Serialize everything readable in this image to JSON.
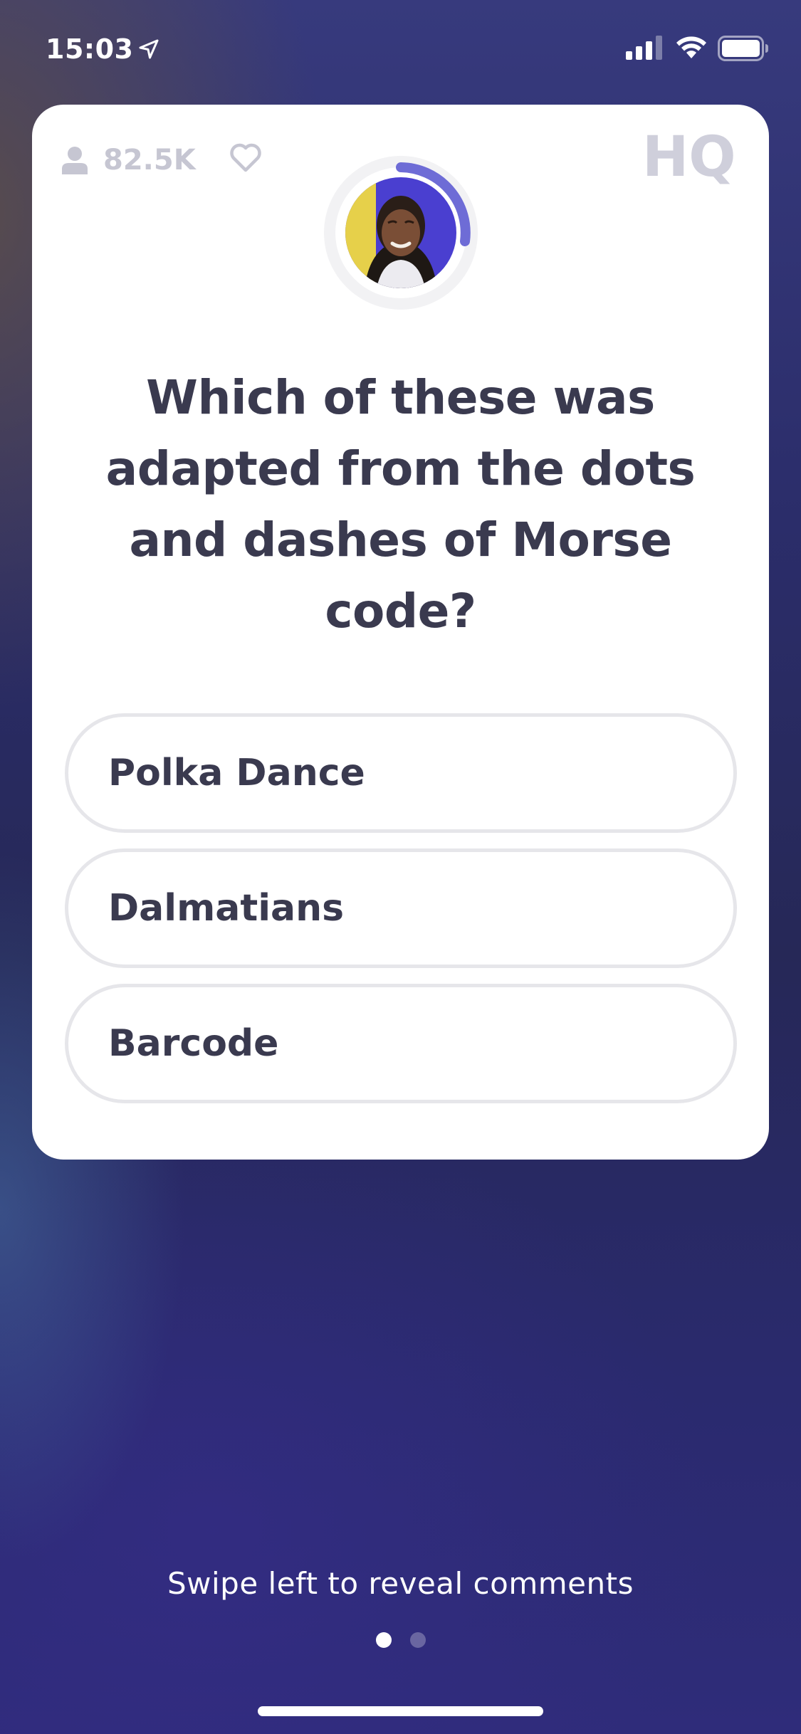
{
  "status_bar": {
    "time": "15:03",
    "icons": [
      "location-arrow-icon",
      "cellular-signal-icon",
      "wifi-icon",
      "battery-icon"
    ]
  },
  "header": {
    "viewer_count": "82.5K",
    "person_icon": "person-icon",
    "heart_icon": "heart-icon",
    "logo": "HQ"
  },
  "host": {
    "avatar_icon": "host-avatar",
    "timer_color": "#6e6cd6"
  },
  "question": {
    "text": "Which of these was adapted from the dots and dashes of Morse code?"
  },
  "answers": [
    {
      "label": "Polka Dance"
    },
    {
      "label": "Dalmatians"
    },
    {
      "label": "Barcode"
    }
  ],
  "footer": {
    "swipe_hint": "Swipe left to reveal comments",
    "pages": 2,
    "active_page": 1
  },
  "colors": {
    "background": "#2a2b6b",
    "card": "#ffffff",
    "text_dark": "#3a3a4f",
    "muted": "#c6c6d2",
    "answer_border": "#e6e6ea"
  }
}
